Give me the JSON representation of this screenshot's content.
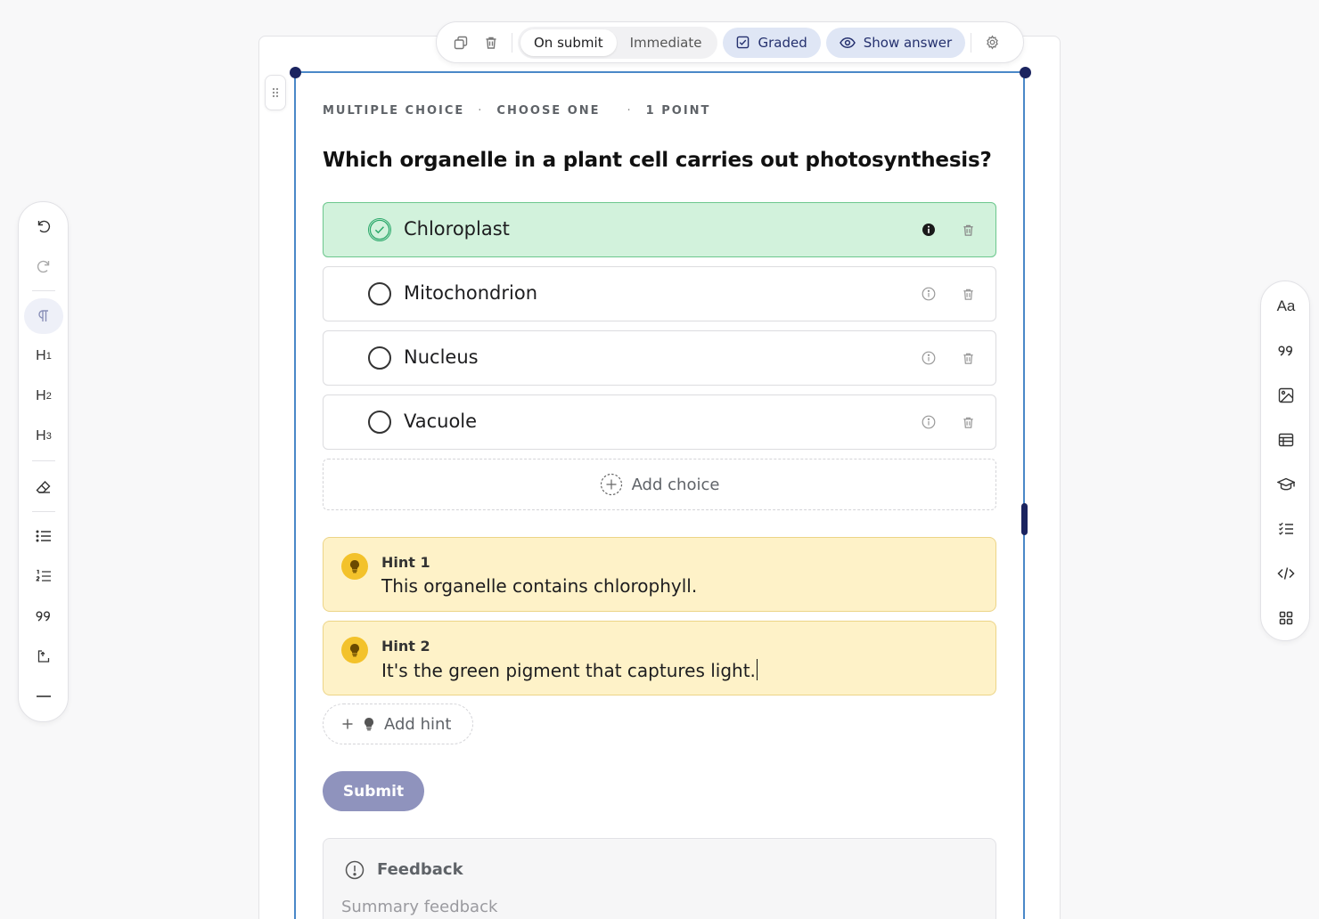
{
  "toolbar": {
    "duplicate_icon": "duplicate-icon",
    "delete_icon": "trash-icon",
    "mode_options": [
      "On submit",
      "Immediate"
    ],
    "mode_selected": "On submit",
    "graded_label": "Graded",
    "show_answer_label": "Show answer",
    "settings_icon": "gear-icon",
    "accent_bg": "#dfe6f5",
    "accent_text": "#24306e"
  },
  "question": {
    "meta": {
      "type": "MULTIPLE CHOICE",
      "mode": "CHOOSE ONE",
      "points": "1 POINT"
    },
    "prompt": "Which organelle in a plant cell carries out photosynthesis?",
    "choices": [
      {
        "label": "Chloroplast",
        "correct": true
      },
      {
        "label": "Mitochondrion",
        "correct": false
      },
      {
        "label": "Nucleus",
        "correct": false
      },
      {
        "label": "Vacuole",
        "correct": false
      }
    ],
    "add_choice_label": "Add choice",
    "hints": [
      {
        "title": "Hint 1",
        "text": "This organelle contains chlorophyll."
      },
      {
        "title": "Hint 2",
        "text": "It's the green pigment that captures light."
      }
    ],
    "add_hint_label": "Add hint",
    "submit_label": "Submit",
    "feedback": {
      "title": "Feedback",
      "placeholder": "Summary feedback"
    },
    "colors": {
      "correct_bg": "#d2f2dc",
      "correct_border": "#6cc78d",
      "hint_bg": "#fef2c8",
      "hint_icon": "#f3c22b",
      "submit_bg": "#8f93bd",
      "selection_border": "#4a88c8",
      "handle": "#1b2460"
    }
  },
  "left_toolbar": {
    "items": [
      {
        "icon": "undo-icon"
      },
      {
        "icon": "redo-icon"
      },
      {
        "icon": "paragraph-icon",
        "active": true
      },
      {
        "icon": "heading-1-icon",
        "label": "H",
        "sub": "1"
      },
      {
        "icon": "heading-2-icon",
        "label": "H",
        "sub": "2"
      },
      {
        "icon": "heading-3-icon",
        "label": "H",
        "sub": "3"
      },
      {
        "icon": "eraser-icon"
      },
      {
        "icon": "bullet-list-icon"
      },
      {
        "icon": "numbered-list-icon"
      },
      {
        "icon": "quote-icon"
      },
      {
        "icon": "callout-icon"
      },
      {
        "icon": "divider-icon"
      }
    ]
  },
  "right_toolbar": {
    "items": [
      {
        "icon": "typography-icon",
        "label": "Aa"
      },
      {
        "icon": "quote-icon"
      },
      {
        "icon": "image-icon"
      },
      {
        "icon": "table-icon"
      },
      {
        "icon": "graduation-cap-icon"
      },
      {
        "icon": "checklist-icon"
      },
      {
        "icon": "code-icon"
      },
      {
        "icon": "grid-icon"
      }
    ]
  }
}
